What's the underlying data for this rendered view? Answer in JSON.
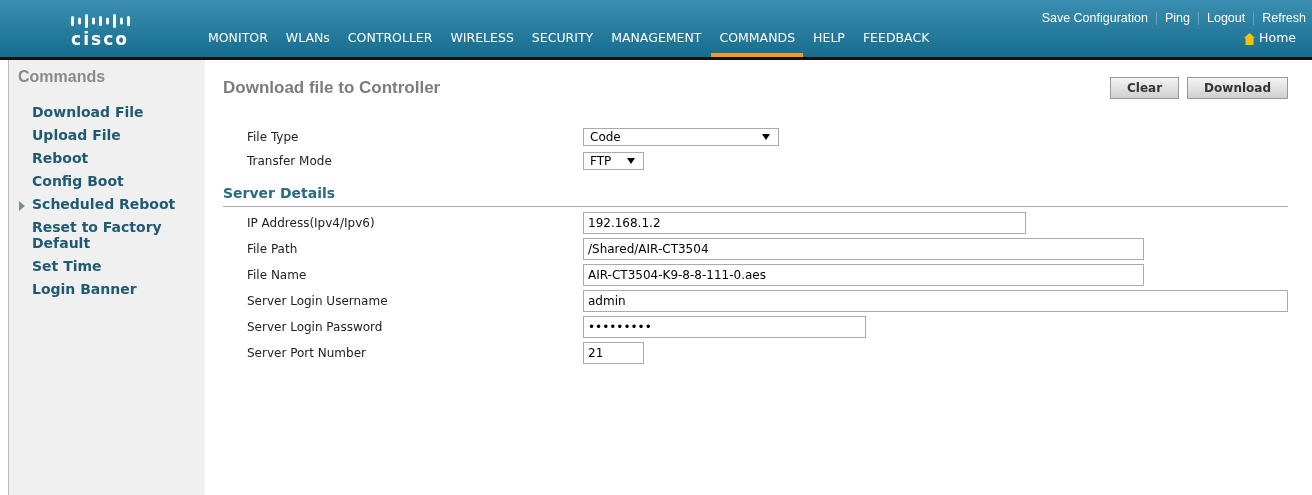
{
  "header": {
    "logo": "cisco",
    "top_links": [
      "Save Configuration",
      "Ping",
      "Logout",
      "Refresh"
    ],
    "nav": [
      {
        "label": "MONITOR",
        "selected": false
      },
      {
        "label": "WLANs",
        "selected": false
      },
      {
        "label": "CONTROLLER",
        "selected": false
      },
      {
        "label": "WIRELESS",
        "selected": false
      },
      {
        "label": "SECURITY",
        "selected": false
      },
      {
        "label": "MANAGEMENT",
        "selected": false
      },
      {
        "label": "COMMANDS",
        "selected": true
      },
      {
        "label": "HELP",
        "selected": false
      },
      {
        "label": "FEEDBACK",
        "selected": false
      }
    ],
    "home": "Home"
  },
  "sidebar": {
    "title": "Commands",
    "items": [
      {
        "label": "Download File",
        "expandable": false
      },
      {
        "label": "Upload File",
        "expandable": false
      },
      {
        "label": "Reboot",
        "expandable": false
      },
      {
        "label": "Config Boot",
        "expandable": false
      },
      {
        "label": "Scheduled Reboot",
        "expandable": true
      },
      {
        "label": "Reset to Factory Default",
        "expandable": false
      },
      {
        "label": "Set Time",
        "expandable": false
      },
      {
        "label": "Login Banner",
        "expandable": false
      }
    ]
  },
  "page": {
    "title": "Download file to Controller",
    "buttons": [
      "Clear",
      "Download"
    ],
    "selects": [
      {
        "label": "File Type",
        "value": "Code"
      },
      {
        "label": "Transfer Mode",
        "value": "FTP"
      }
    ],
    "section": "Server Details",
    "fields": [
      {
        "label": "IP Address(Ipv4/Ipv6)",
        "value": "192.168.1.2"
      },
      {
        "label": "File Path",
        "value": "/Shared/AIR-CT3504"
      },
      {
        "label": "File Name",
        "value": "AIR-CT3504-K9-8-8-111-0.aes"
      },
      {
        "label": "Server Login Username",
        "value": "admin"
      },
      {
        "label": "Server Login Password",
        "value": "•••••••••"
      },
      {
        "label": "Server Port Number",
        "value": "21"
      }
    ]
  }
}
